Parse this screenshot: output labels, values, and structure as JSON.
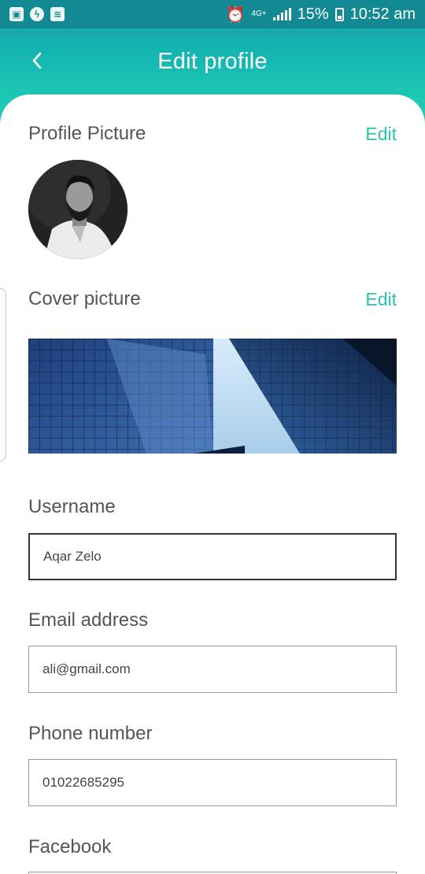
{
  "status_bar": {
    "network": "4G+",
    "battery": "15%",
    "time": "10:52 am"
  },
  "header": {
    "title": "Edit profile"
  },
  "profile_picture": {
    "label": "Profile Picture",
    "edit_label": "Edit"
  },
  "cover_picture": {
    "label": "Cover picture",
    "edit_label": "Edit"
  },
  "form": {
    "username": {
      "label": "Username",
      "value": "Aqar Zelo"
    },
    "email": {
      "label": "Email address",
      "value": "ali@gmail.com"
    },
    "phone": {
      "label": "Phone number",
      "value": "01022685295"
    },
    "facebook": {
      "label": "Facebook",
      "value": ""
    }
  },
  "colors": {
    "accent": "#2cc2ad",
    "header_gradient_top": "#138a93",
    "header_gradient_bottom": "#1ec9b4"
  }
}
